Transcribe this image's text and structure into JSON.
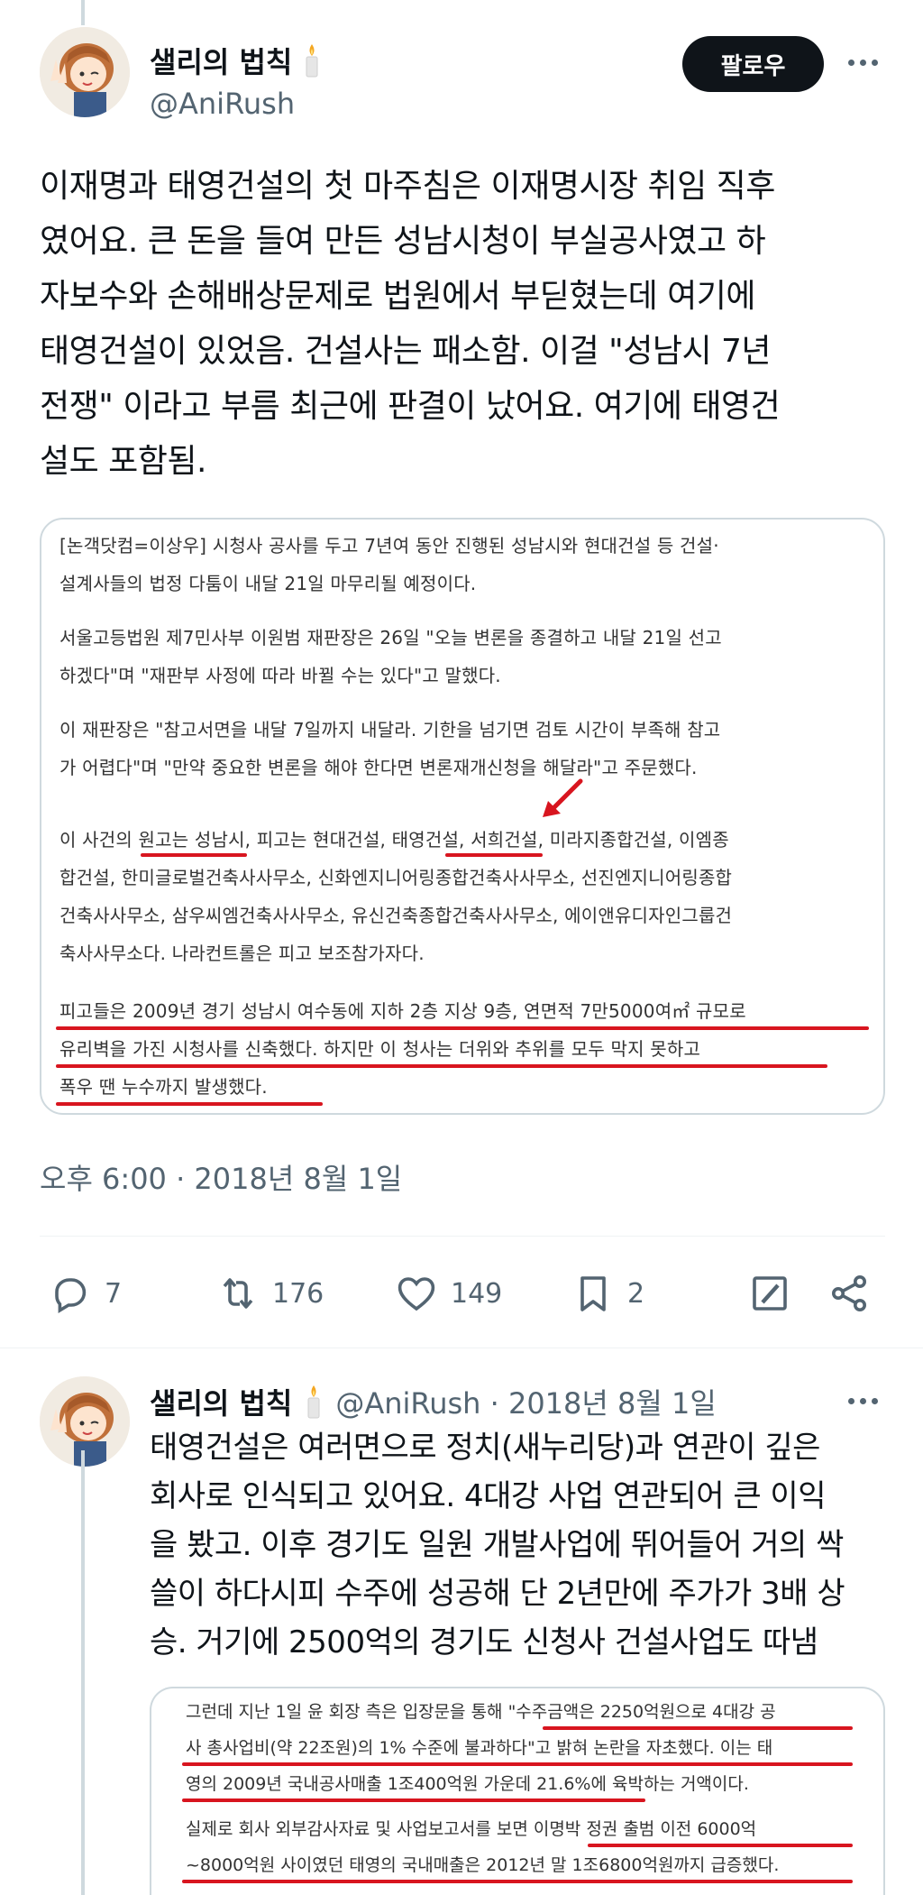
{
  "main_tweet": {
    "author_name": "샐리의 법칙",
    "author_emoji": "candle-emoji",
    "handle": "@AniRush",
    "follow_label": "팔로우",
    "text_lines": [
      "이재명과 태영건설의 첫 마주침은 이재명시장 취임 직후",
      "였어요. 큰 돈을 들여 만든 성남시청이 부실공사였고 하",
      "자보수와 손해배상문제로 법원에서 부딛혔는데 여기에",
      "태영건설이 있었음. 건설사는 패소함. 이걸 \"성남시 7년",
      "전쟁\" 이라고 부름 최근에 판결이 났어요. 여기에 태영건",
      "설도 포함됨."
    ],
    "image_article_lines": [
      "[논객닷컴=이상우] 시청사 공사를 두고 7년여 동안 진행된 성남시와 현대건설 등 건설·",
      "설계사들의 법정 다툼이 내달 21일 마무리될 예정이다.",
      "서울고등법원 제7민사부 이원범 재판장은 26일 \"오늘 변론을 종결하고 내달 21일 선고",
      "하겠다\"며 \"재판부 사정에 따라 바뀔 수는 있다\"고 말했다.",
      "이 재판장은 \"참고서면을 내달 7일까지 내달라. 기한을 넘기면 검토 시간이 부족해 참고",
      "가 어렵다\"며 \"만약 중요한 변론을 해야 한다면 변론재개신청을 해달라\"고 주문했다.",
      "이 사건의 원고는 성남시, 피고는 현대건설, 태영건설, 서희건설, 미라지종합건설, 이엠종",
      "합건설, 한미글로벌건축사사무소, 신화엔지니어링종합건축사사무소, 선진엔지니어링종합",
      "건축사사무소, 삼우씨엠건축사사무소, 유신건축종합건축사사무소, 에이앤유디자인그룹건",
      "축사사무소다. 나라컨트롤은 피고 보조참가자다.",
      "피고들은 2009년 경기 성남시 여수동에 지하 2층 지상 9층, 연면적 7만5000여㎡ 규모로",
      "유리벽을 가진 시청사를 신축했다. 하지만 이 청사는 더위와 추위를 모두 막지 못하고",
      "폭우 땐 누수까지 발생했다."
    ],
    "timestamp": "오후 6:00 · 2018년 8월 1일",
    "stats": {
      "replies": "7",
      "retweets": "176",
      "likes": "149",
      "bookmarks": "2"
    }
  },
  "reply_tweet": {
    "author_name": "샐리의 법칙",
    "author_emoji": "candle-emoji",
    "handle_date": "@AniRush · 2018년 8월 1일",
    "text_lines": [
      "태영건설은 여러면으로 정치(새누리당)과 연관이 깊은",
      "회사로 인식되고 있어요. 4대강 사업 연관되어 큰 이익",
      "을 봤고. 이후 경기도 일원 개발사업에 뛰어들어 거의 싹",
      "쓸이 하다시피 수주에 성공해 단 2년만에 주가가 3배 상",
      "승. 거기에 2500억의 경기도 신청사 건설사업도 따냄"
    ],
    "image_article_lines": [
      "그런데 지난 1일 윤 회장 측은 입장문을 통해 \"수주금액은 2250억원으로 4대강 공",
      "사 총사업비(약 22조원)의 1% 수준에 불과하다\"고 밝혀 논란을 자초했다. 이는 태",
      "영의 2009년 국내공사매출 1조400억원 가운데 21.6%에 육박하는 거액이다.",
      "실제로 회사 외부감사자료 및 사업보고서를 보면 이명박 정권 출범 이전 6000억",
      "~8000억원 사이였던 태영의 국내매출은 2012년 말 1조6800억원까지 급증했다."
    ]
  },
  "colors": {
    "text": "#0f1419",
    "secondary": "#536471",
    "border": "#cfd9de",
    "underline_red": "#d8151f",
    "follow_bg": "#0f1419"
  }
}
